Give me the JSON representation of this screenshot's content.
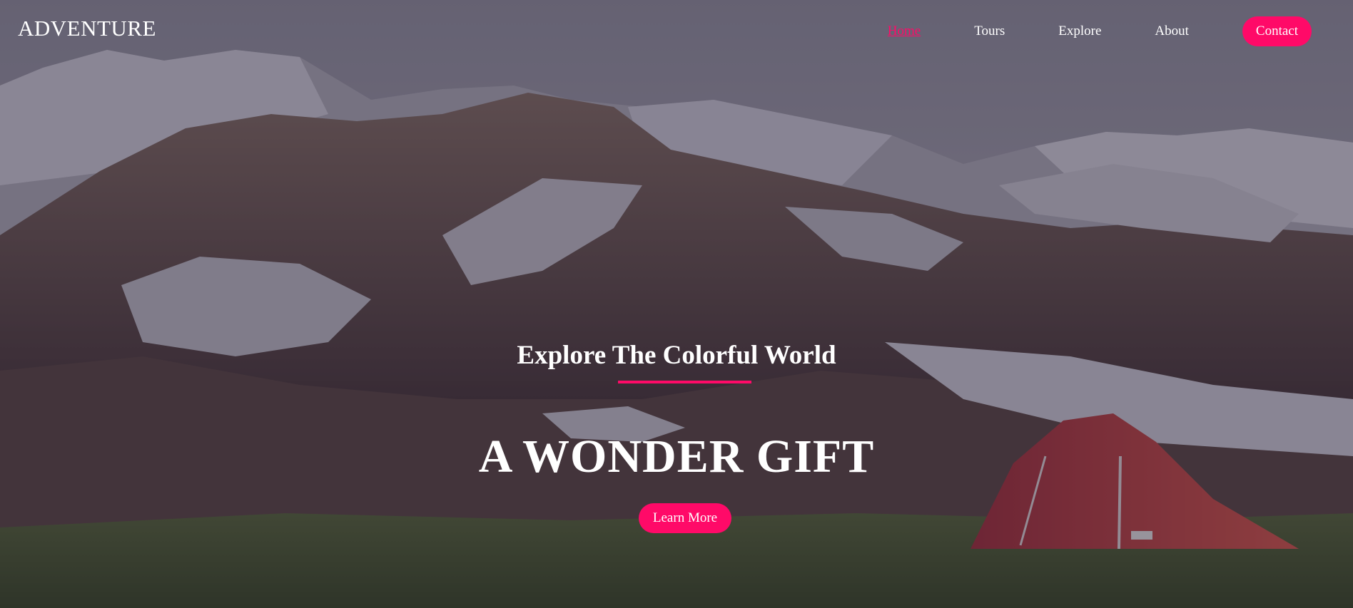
{
  "header": {
    "logo": "ADVENTURE",
    "nav": [
      {
        "label": "Home",
        "active": true
      },
      {
        "label": "Tours",
        "active": false
      },
      {
        "label": "Explore",
        "active": false
      },
      {
        "label": "About",
        "active": false
      }
    ],
    "contact_label": "Contact"
  },
  "hero": {
    "subtitle": "Explore The Colorful World",
    "headline": "A WONDER GIFT",
    "cta_label": "Learn More"
  },
  "colors": {
    "accent": "#ff0a68",
    "text": "#ffffff"
  }
}
